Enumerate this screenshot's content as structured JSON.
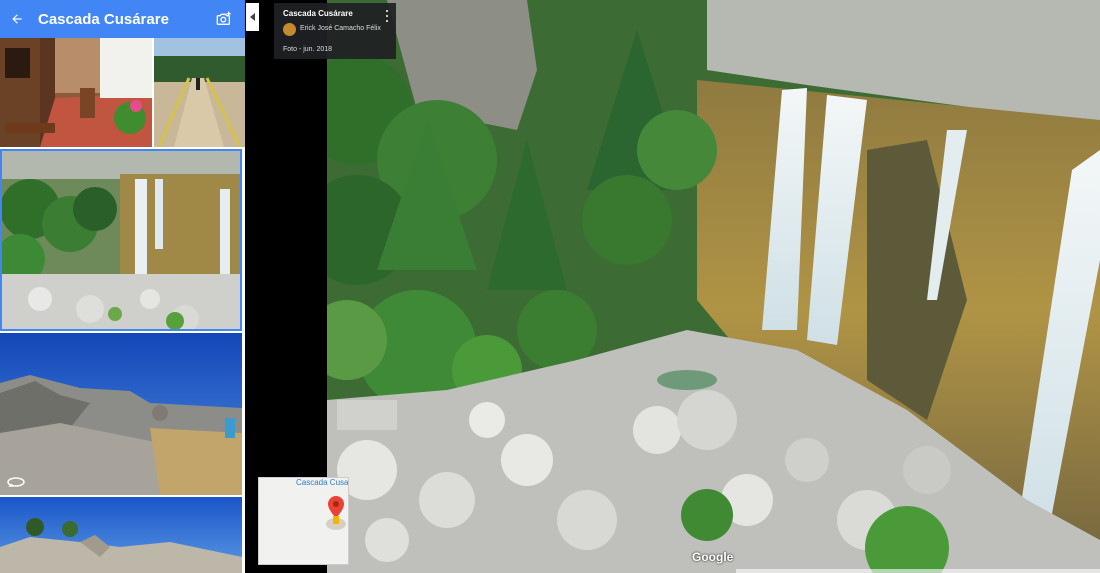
{
  "header": {
    "title": "Cascada Cusárare",
    "back_icon": "arrow-back-icon",
    "camera_icon": "add-photo-icon"
  },
  "gallery": {
    "items": [
      {
        "name": "porch-photo"
      },
      {
        "name": "bridge-photo"
      },
      {
        "name": "waterfall-photo",
        "selected": true
      },
      {
        "name": "rocks-photo"
      },
      {
        "name": "sky-photo"
      }
    ],
    "accent_color": "#4285f4"
  },
  "info_card": {
    "title": "Cascada Cusárare",
    "author": "Erick José Camacho Félix",
    "date": "Foto - jun. 2018"
  },
  "minimap": {
    "label": "Cascada Cusa"
  },
  "brand": {
    "logo_text": "Google"
  },
  "colors": {
    "header_bg": "#4285f4",
    "card_bg": "#202124"
  }
}
